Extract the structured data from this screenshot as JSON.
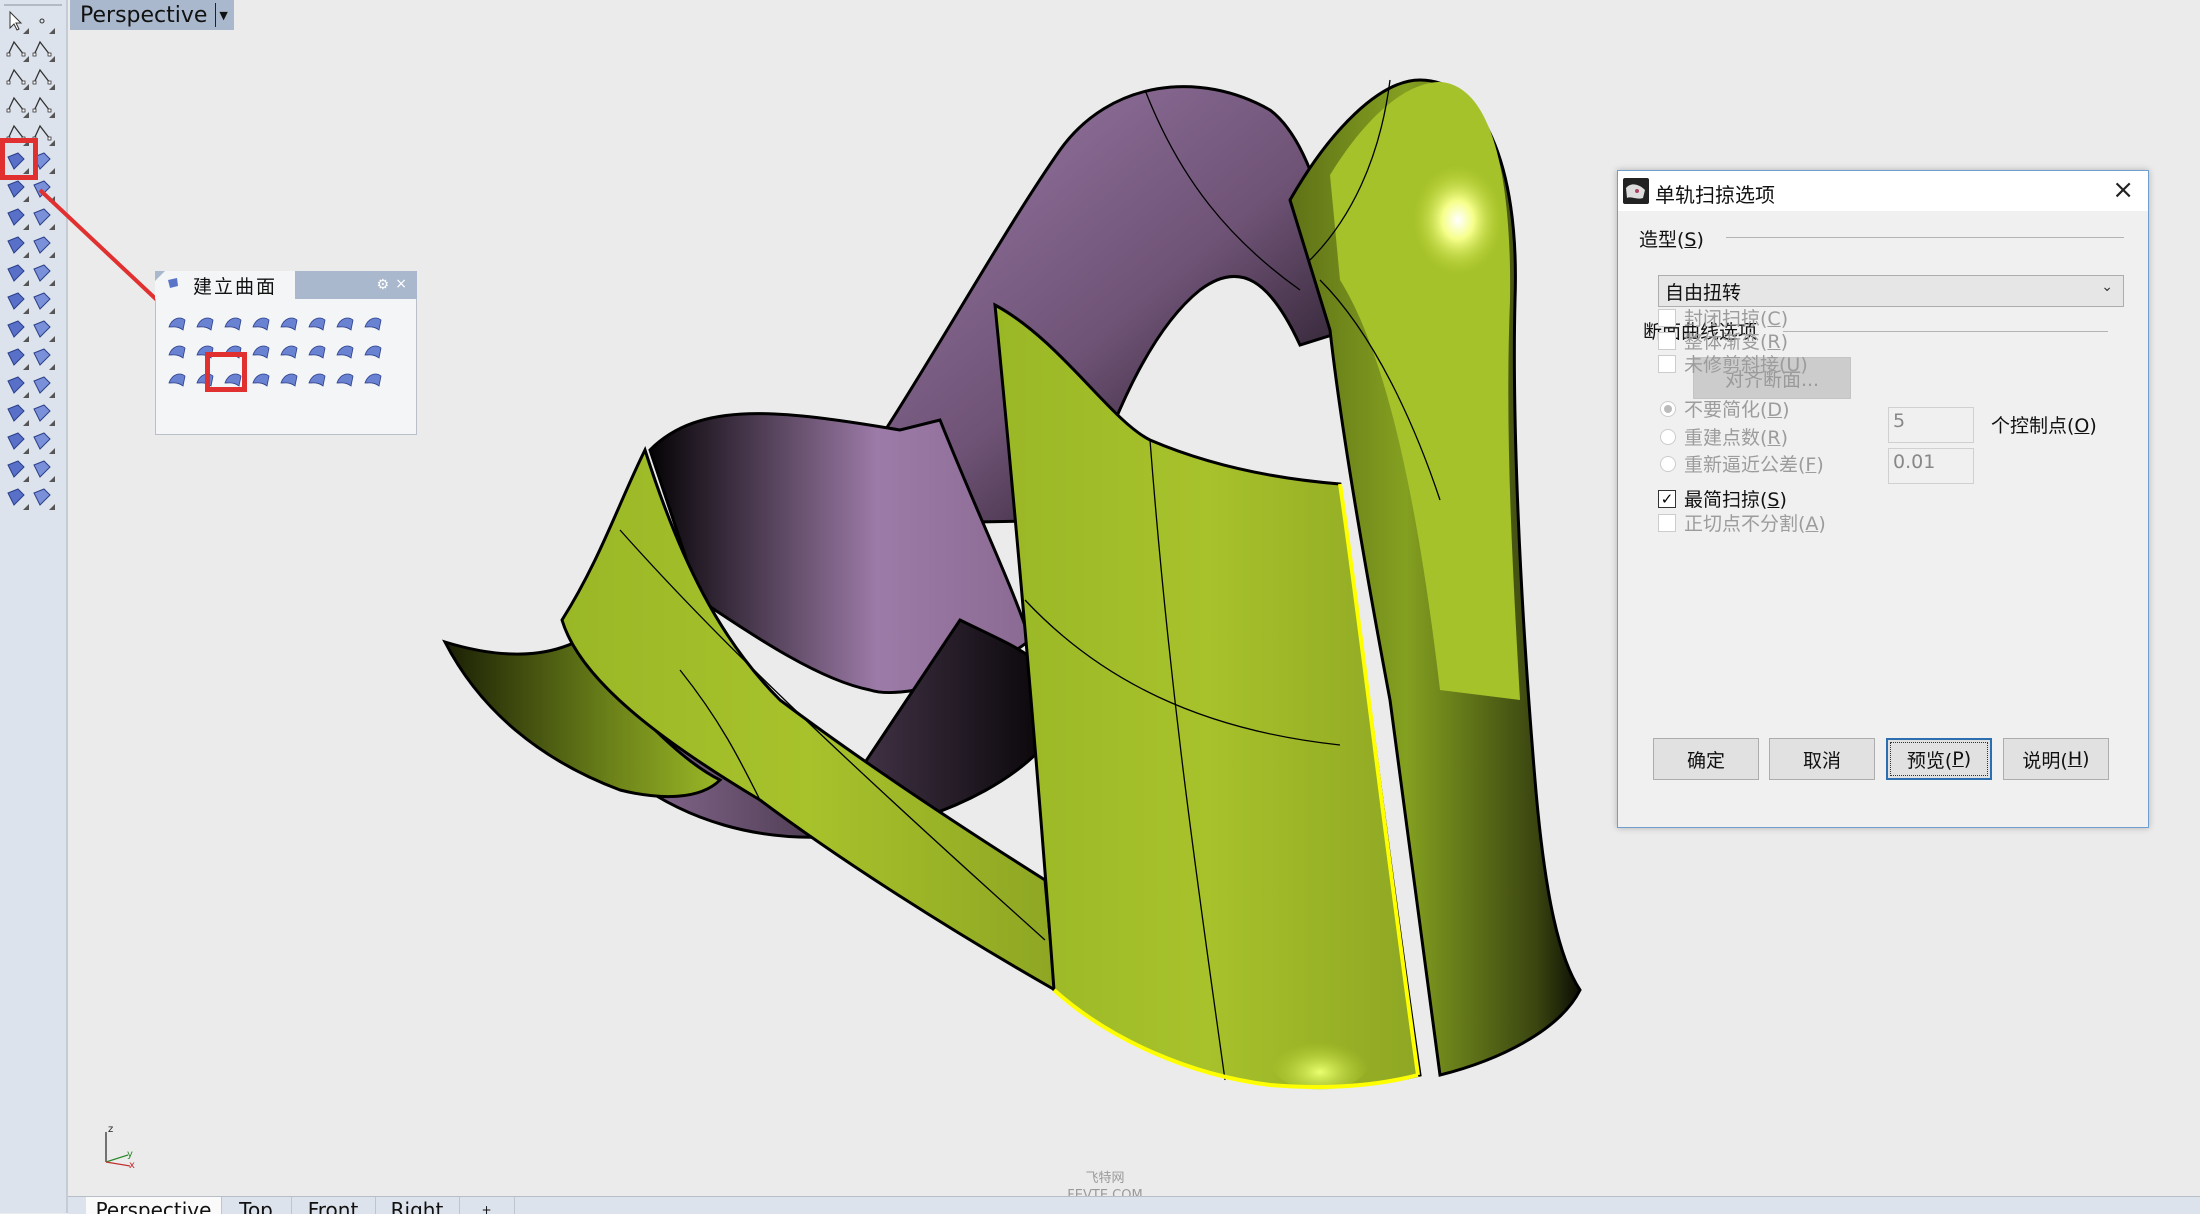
{
  "viewport": {
    "title": "Perspective",
    "title_dropdown_icon": "dropdown-arrow",
    "axis": {
      "z": "z",
      "y": "y",
      "x": "x"
    },
    "tabs": [
      "Perspective",
      "Top",
      "Front",
      "Right",
      "+"
    ],
    "active_tab": "Perspective",
    "watermark": {
      "line1": "飞特网",
      "line2": "FEVTE.COM"
    },
    "model": {
      "primary_color": "#9fba25",
      "backface_color": "#9a7aa0",
      "highlight_edge_color": "#ffff00"
    }
  },
  "left_toolbar": {
    "buttons": [
      {
        "icon": "select-arrow-icon"
      },
      {
        "icon": "point-icon"
      },
      {
        "icon": "polyline-icon"
      },
      {
        "icon": "curve-icon"
      },
      {
        "icon": "circle-icon"
      },
      {
        "icon": "ellipse-icon"
      },
      {
        "icon": "arc-icon"
      },
      {
        "icon": "rectangle-icon"
      },
      {
        "icon": "polygon-icon"
      },
      {
        "icon": "fillet-curve-icon"
      },
      {
        "icon": "surface-from-points-icon",
        "highlighted": true
      },
      {
        "icon": "surface-icon"
      },
      {
        "icon": "box-icon"
      },
      {
        "icon": "sphere-union-icon"
      },
      {
        "icon": "cylinder-icon"
      },
      {
        "icon": "mesh-surface-icon"
      },
      {
        "icon": "boolean-puzzle-icon"
      },
      {
        "icon": "explode-icon"
      },
      {
        "icon": "trim-icon"
      },
      {
        "icon": "split-icon"
      },
      {
        "icon": "boolean-union-icon"
      },
      {
        "icon": "group-icon"
      },
      {
        "icon": "offset-curve-icon"
      },
      {
        "icon": "offset-dashed-icon"
      },
      {
        "icon": "text-icon"
      },
      {
        "icon": "scale-icon"
      },
      {
        "icon": "array-icon"
      },
      {
        "icon": "transform-icon"
      },
      {
        "icon": "solid-edit-icon"
      },
      {
        "icon": "contour-icon"
      },
      {
        "icon": "grid-array-icon"
      },
      {
        "icon": "align-icon"
      },
      {
        "icon": "analyze-icon"
      },
      {
        "icon": "check-icon"
      },
      {
        "icon": "render-icon"
      },
      {
        "icon": "material-icon"
      }
    ],
    "highlight_color": "#e03030"
  },
  "surface_panel": {
    "title": "建立曲面",
    "gear_icon": "⚙",
    "close_icon": "×",
    "tools": [
      "surface-from-corners-icon",
      "patch-icon",
      "surface-from-points-icon",
      "loft-icon",
      "edge-surface-icon",
      "network-surface-icon",
      "plane-icon",
      "plane-3pt-icon",
      "vertical-plane-icon",
      "rectangle-plane-icon",
      "cutting-plane-icon",
      "heightfield-icon",
      "extrude-icon",
      "extrude-curve-icon",
      "extrude-tapered-icon",
      "extrude-to-point-icon",
      "sweep-2-rail-icon",
      "rail-revolve-icon",
      "sweep-1-rail-icon",
      "sweep-2-icon",
      "revolve-icon",
      "drape-icon",
      "heightfield-image-icon",
      "point-grid-icon"
    ],
    "highlighted_tool": "sweep-1-rail-icon"
  },
  "dialog": {
    "title": "单轨扫掠选项",
    "close_icon": "×",
    "shape_group": {
      "label": "造型(",
      "mnemonic": "S",
      "label_end": ")"
    },
    "shape_select": {
      "value": "自由扭转"
    },
    "checkboxes_top": [
      {
        "label": "封闭扫掠(",
        "mnemonic": "C",
        "end": ")",
        "checked": false,
        "enabled": false
      },
      {
        "label": "整体渐变(",
        "mnemonic": "R",
        "end": ")",
        "checked": false,
        "enabled": false
      },
      {
        "label": "未修剪斜接(",
        "mnemonic": "U",
        "end": ")",
        "checked": false,
        "enabled": false
      }
    ],
    "section_group": {
      "label": "断面曲线选项"
    },
    "align_button": "对齐断面...",
    "radios": [
      {
        "label": "不要简化(",
        "mnemonic": "D",
        "end": ")",
        "selected": true,
        "enabled": false
      },
      {
        "label": "重建点数(",
        "mnemonic": "R",
        "end": ")",
        "selected": false,
        "enabled": false
      },
      {
        "label": "重新逼近公差(",
        "mnemonic": "F",
        "end": ")",
        "selected": false,
        "enabled": false
      }
    ],
    "rebuild_points_value": "5",
    "control_points_label": {
      "label": "个控制点(",
      "mnemonic": "O",
      "end": ")"
    },
    "refit_tolerance_value": "0.01",
    "checkboxes_bottom": [
      {
        "label": "最简扫掠(",
        "mnemonic": "S",
        "end": ")",
        "checked": true,
        "enabled": true
      },
      {
        "label": "正切点不分割(",
        "mnemonic": "A",
        "end": ")",
        "checked": false,
        "enabled": false
      }
    ],
    "buttons": {
      "ok": "确定",
      "cancel": "取消",
      "preview": {
        "label": "预览(",
        "mnemonic": "P",
        "end": ")"
      },
      "help": {
        "label": "说明(",
        "mnemonic": "H",
        "end": ")"
      }
    }
  }
}
